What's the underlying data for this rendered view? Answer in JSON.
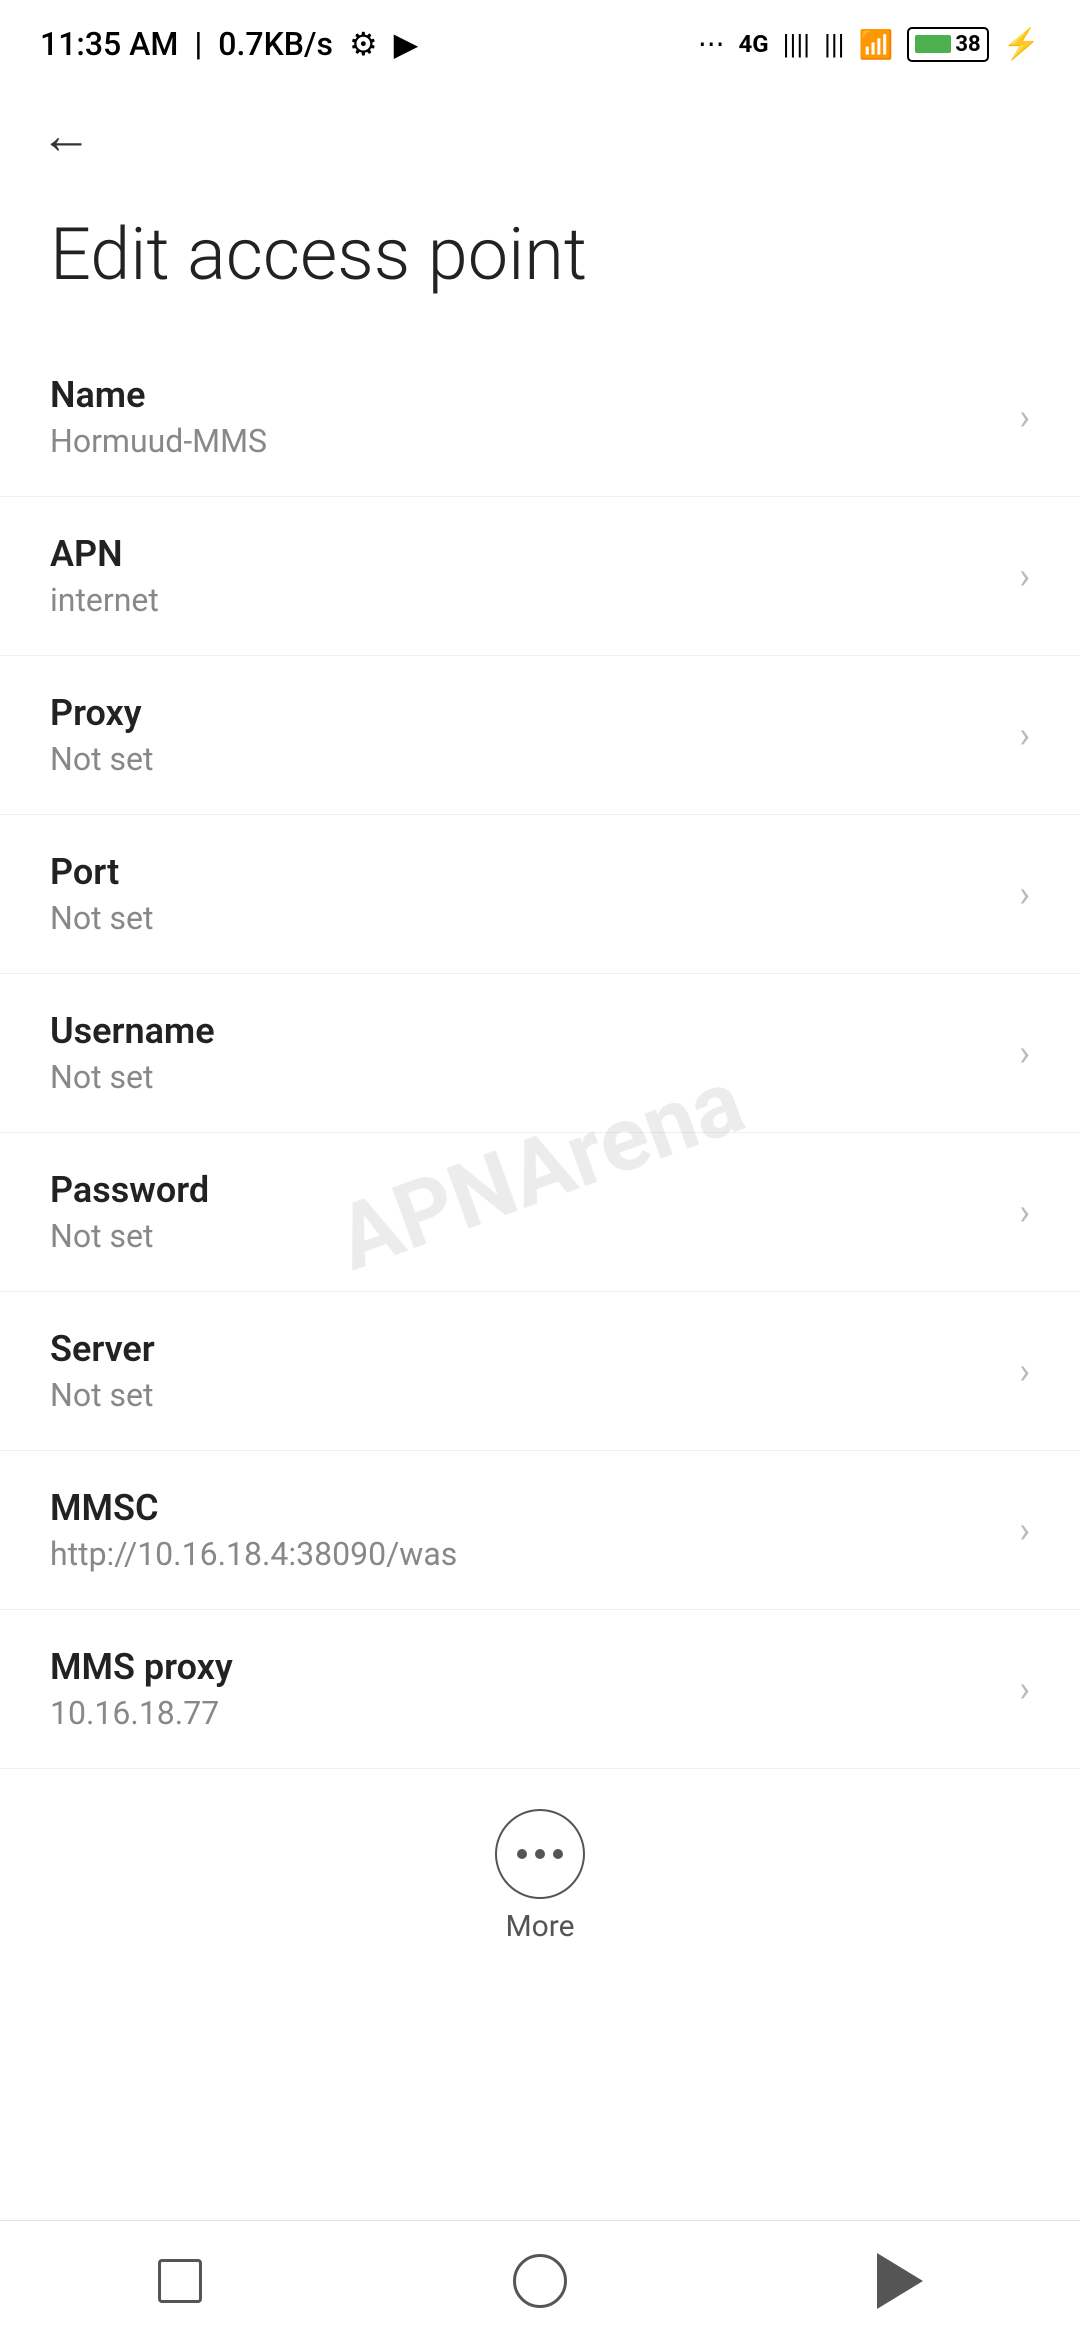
{
  "statusBar": {
    "time": "11:35 AM",
    "speed": "0.7KB/s"
  },
  "nav": {
    "backLabel": "←"
  },
  "page": {
    "title": "Edit access point"
  },
  "settings": [
    {
      "id": "name",
      "label": "Name",
      "value": "Hormuud-MMS"
    },
    {
      "id": "apn",
      "label": "APN",
      "value": "internet"
    },
    {
      "id": "proxy",
      "label": "Proxy",
      "value": "Not set"
    },
    {
      "id": "port",
      "label": "Port",
      "value": "Not set"
    },
    {
      "id": "username",
      "label": "Username",
      "value": "Not set"
    },
    {
      "id": "password",
      "label": "Password",
      "value": "Not set"
    },
    {
      "id": "server",
      "label": "Server",
      "value": "Not set"
    },
    {
      "id": "mmsc",
      "label": "MMSC",
      "value": "http://10.16.18.4:38090/was"
    },
    {
      "id": "mms-proxy",
      "label": "MMS proxy",
      "value": "10.16.18.77"
    }
  ],
  "more": {
    "label": "More"
  },
  "watermark": "APNArena"
}
